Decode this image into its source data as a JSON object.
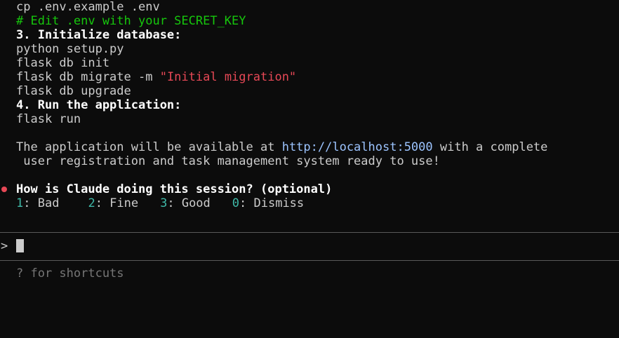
{
  "output": {
    "l1": "cp .env.example .env",
    "l2": "# Edit .env with your SECRET_KEY",
    "l3": "3. Initialize database:",
    "l4": "python setup.py",
    "l5": "flask db init",
    "l6_cmd": "flask db migrate -m ",
    "l6_str": "\"Initial migration\"",
    "l7": "flask db upgrade",
    "l8": "4. Run the application:",
    "l9": "flask run",
    "l10_pre": "The application will be available at ",
    "l10_link": "http://localhost:5000",
    "l10_post": " with a complete",
    "l11": " user registration and task management system ready to use!"
  },
  "feedback": {
    "question": "How is Claude doing this session? (optional)",
    "options": [
      {
        "key": "1",
        "label": ": Bad"
      },
      {
        "key": "2",
        "label": ": Fine"
      },
      {
        "key": "3",
        "label": ": Good"
      },
      {
        "key": "0",
        "label": ": Dismiss"
      }
    ]
  },
  "input": {
    "prompt": ">",
    "value": ""
  },
  "footer": {
    "hint": "? for shortcuts"
  },
  "colors": {
    "background": "#0c0c0c",
    "comment": "#16c60c",
    "string": "#e74856",
    "link": "#9cc4ff",
    "option_key": "#3fb9a8"
  }
}
